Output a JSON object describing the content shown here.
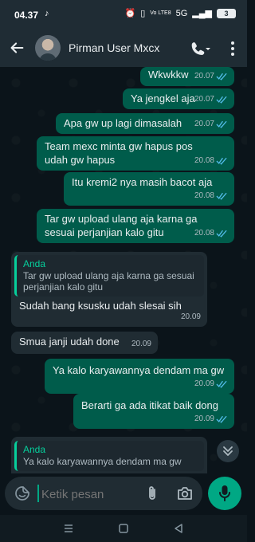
{
  "status_bar": {
    "time": "04.37",
    "app_icon": "tiktok-icon",
    "network_label": "Vo LTE8",
    "signal_label": "5G",
    "battery": "3"
  },
  "header": {
    "contact_name": "Pirman User Mxcx",
    "back_icon": "arrow-left-icon",
    "call_icon": "phone-icon",
    "menu_icon": "more-vertical-icon"
  },
  "messages": [
    {
      "direction": "outgoing",
      "text": "Wkwkkw",
      "time": "20.07",
      "status": "read"
    },
    {
      "direction": "outgoing",
      "text": "Ya jengkel aja",
      "time": "20.07",
      "status": "read"
    },
    {
      "direction": "outgoing",
      "text": "Apa gw up lagi dimasalah",
      "time": "20.07",
      "status": "read"
    },
    {
      "direction": "outgoing",
      "text": "Team mexc minta gw hapus pos\nudah gw hapus",
      "time": "20.08",
      "status": "read"
    },
    {
      "direction": "outgoing",
      "text": "Itu kremi2 nya masih bacot aja",
      "time": "20.08",
      "status": "read"
    },
    {
      "direction": "outgoing",
      "text": "Tar gw upload ulang aja karna ga\nsesuai perjanjian kalo gitu",
      "time": "20.08",
      "status": "read"
    },
    {
      "direction": "incoming",
      "quoted_name": "Anda",
      "quoted_text": "Tar gw upload ulang aja karna ga sesuai\nperjanjian kalo gitu",
      "text": "Sudah bang ksusku udah slesai sih",
      "time": "20.09"
    },
    {
      "direction": "incoming",
      "text": "Smua janji udah done",
      "time": "20.09"
    },
    {
      "direction": "outgoing",
      "text": "Ya kalo karyawannya dendam ma gw",
      "time": "20.09",
      "status": "read"
    },
    {
      "direction": "outgoing",
      "text": "Berarti ga ada itikat baik dong",
      "time": "20.09",
      "status": "read"
    }
  ],
  "reply_preview": {
    "name": "Anda",
    "text": "Ya kalo karyawannya dendam ma gw"
  },
  "composer": {
    "placeholder": "Ketik pesan",
    "emoji_icon": "sticker-icon",
    "attach_icon": "paperclip-icon",
    "camera_icon": "camera-icon",
    "mic_icon": "microphone-icon"
  },
  "navigation": [
    "menu-icon",
    "home-icon",
    "back-triangle-icon"
  ],
  "colors": {
    "background": "#0b141a",
    "header": "#1f2c34",
    "outgoing_bubble": "#005c4b",
    "incoming_bubble": "#202c33",
    "accent": "#00a884",
    "read_tick": "#53bdeb"
  }
}
